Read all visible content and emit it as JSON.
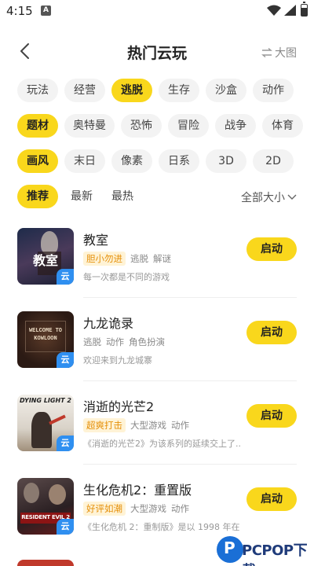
{
  "status_bar": {
    "time": "4:15",
    "notif_badge": "A"
  },
  "header": {
    "title": "热门云玩",
    "view_toggle_icon": "swap-icon",
    "view_toggle_label": "大图"
  },
  "filters": {
    "row1": [
      {
        "label": "玩法",
        "active": false
      },
      {
        "label": "经营",
        "active": false
      },
      {
        "label": "逃脱",
        "active": true
      },
      {
        "label": "生存",
        "active": false
      },
      {
        "label": "沙盒",
        "active": false
      },
      {
        "label": "动作",
        "active": false
      }
    ],
    "row2": [
      {
        "label": "题材",
        "active": true
      },
      {
        "label": "奥特曼",
        "active": false
      },
      {
        "label": "恐怖",
        "active": false
      },
      {
        "label": "冒险",
        "active": false
      },
      {
        "label": "战争",
        "active": false
      },
      {
        "label": "体育",
        "active": false
      }
    ],
    "row3": [
      {
        "label": "画风",
        "active": true
      },
      {
        "label": "末日",
        "active": false
      },
      {
        "label": "像素",
        "active": false
      },
      {
        "label": "日系",
        "active": false
      },
      {
        "label": "3D",
        "active": false
      },
      {
        "label": "2D",
        "active": false
      }
    ],
    "row4": [
      {
        "label": "推荐",
        "active": true
      },
      {
        "label": "最新",
        "active": false
      },
      {
        "label": "最热",
        "active": false
      }
    ],
    "size_filter": "全部大小"
  },
  "games": [
    {
      "name": "教室",
      "thumb_text": "教室",
      "cloud_badge": "云",
      "hot_tag": "胆小勿进",
      "tags": [
        "逃脱",
        "解谜"
      ],
      "desc": "每一次都是不同的游戏",
      "start_label": "启动",
      "thumb_color": "#2a3a5a"
    },
    {
      "name": "九龙诡录",
      "thumb_text": "WELCOME TO KOWLOON",
      "cloud_badge": "云",
      "hot_tag": "",
      "tags": [
        "逃脱",
        "动作",
        "角色扮演"
      ],
      "desc": "欢迎来到九龙城寨",
      "start_label": "启动",
      "thumb_color": "#2b1a14"
    },
    {
      "name": "消逝的光芒2",
      "thumb_text": "DYING LIGHT 2",
      "cloud_badge": "云",
      "hot_tag": "超爽打击",
      "tags": [
        "大型游戏",
        "动作"
      ],
      "desc": "《消逝的光芒2》为该系列的延续交上了...",
      "start_label": "启动",
      "thumb_color": "#d9d2c8"
    },
    {
      "name": "生化危机2：重置版",
      "thumb_text": "RESIDENT EVIL 2",
      "cloud_badge": "云",
      "hot_tag": "好评如潮",
      "tags": [
        "大型游戏",
        "动作"
      ],
      "desc": "《生化危机 2：重制版》是以 1998 年在...",
      "start_label": "启动",
      "thumb_color": "#3a2a2a"
    }
  ],
  "watermark": {
    "text": "PCPOP下载"
  }
}
